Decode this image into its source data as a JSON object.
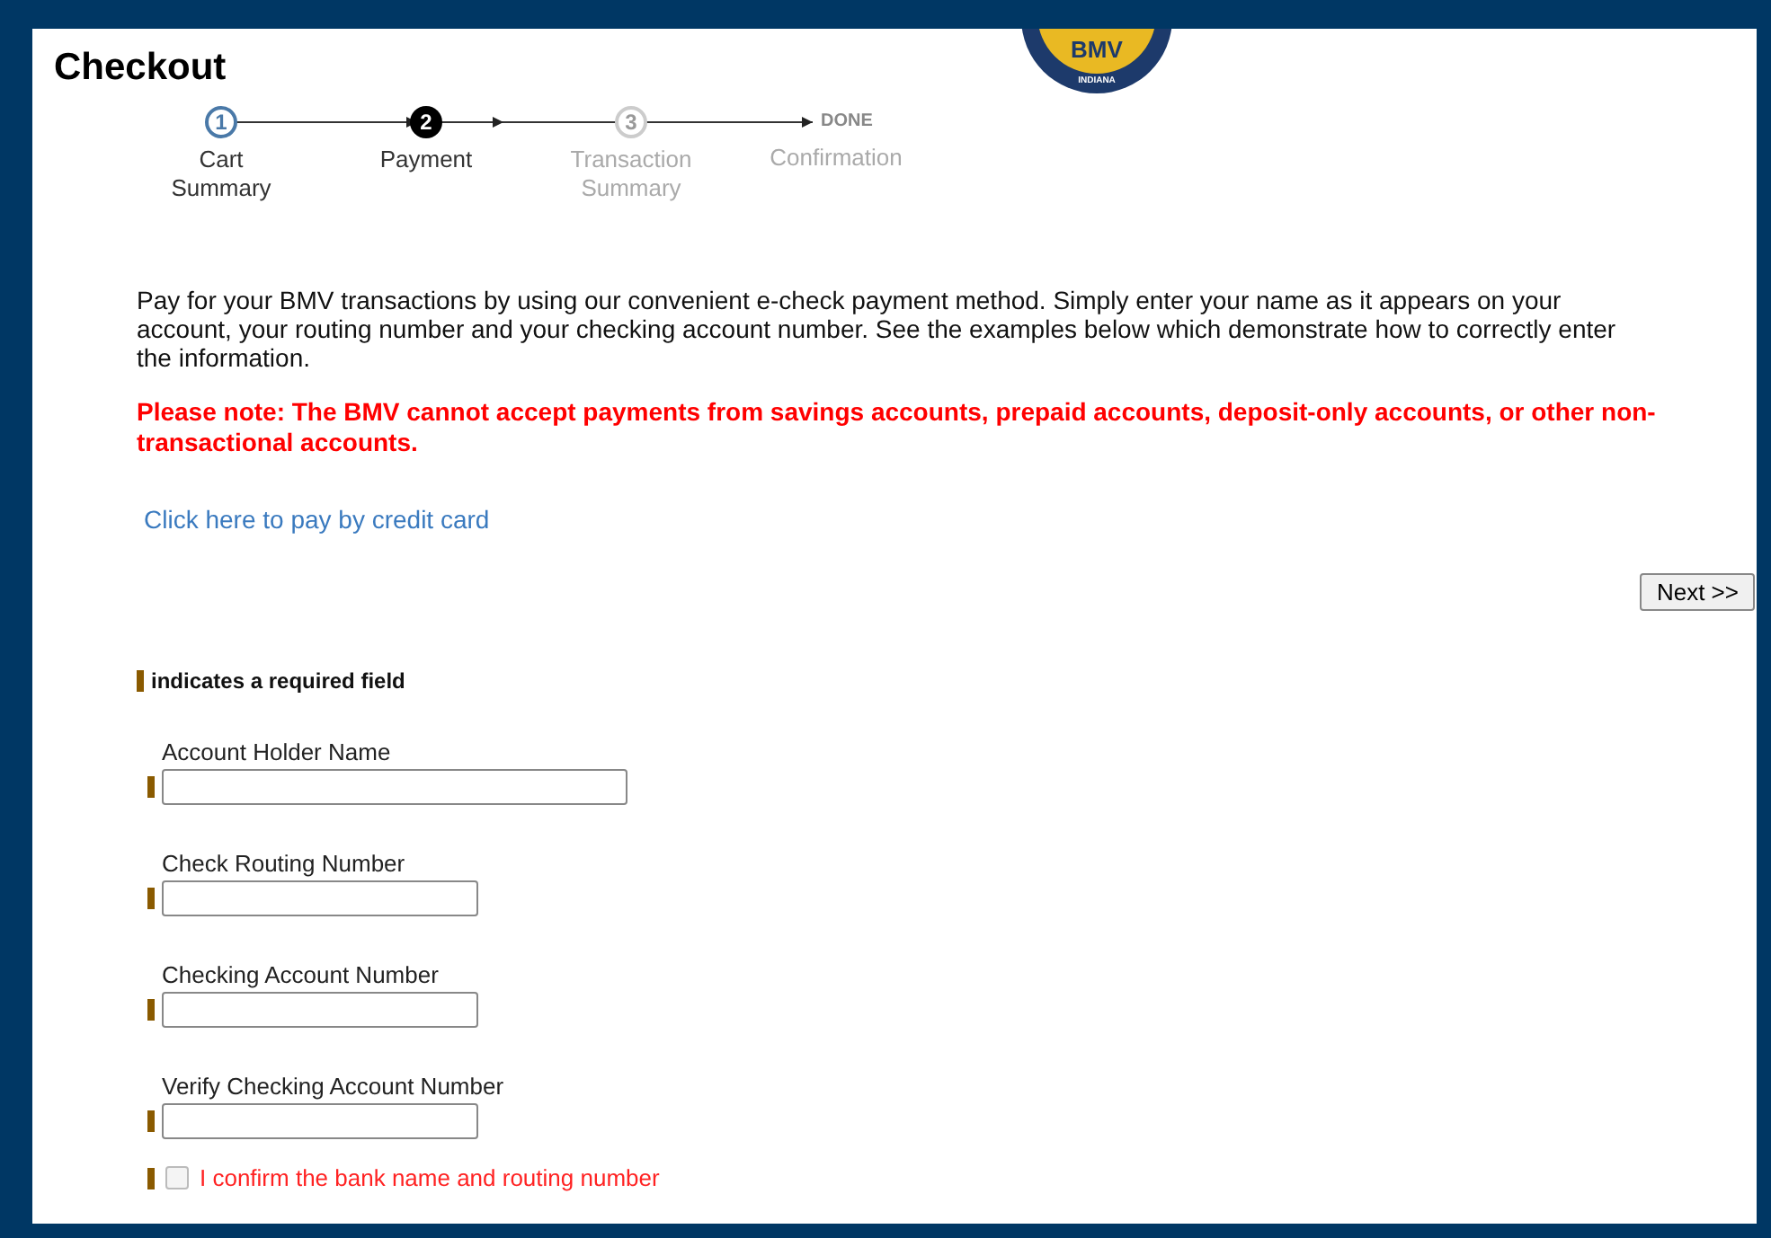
{
  "page": {
    "title": "Checkout"
  },
  "logo": {
    "text": "BMV",
    "subtext": "INDIANA"
  },
  "steps": [
    {
      "kind": "step",
      "number": "1",
      "label": "Cart Summary",
      "completed": true,
      "selected": false
    },
    {
      "kind": "step",
      "number": "2",
      "label": "Payment",
      "completed": false,
      "selected": true
    },
    {
      "kind": "step",
      "number": "3",
      "label": "Transaction Summary",
      "completed": false,
      "selected": false
    },
    {
      "kind": "end",
      "number": "DONE",
      "label": "Confirmation",
      "completed": false,
      "selected": false
    }
  ],
  "intro": "Pay for your BMV transactions by using our convenient e-check payment method.  Simply enter your name as it appears on your account, your routing number and your checking account number.  See the examples below which demonstrate how to correctly enter the information.",
  "note": "Please note: The BMV cannot accept payments from savings accounts, prepaid accounts, deposit-only accounts, or other non-transactional accounts.",
  "credit_card_link": "Click here to pay by credit card",
  "next_button": "Next >>",
  "required_legend": "indicates a required field",
  "fields": [
    {
      "label": "Account Holder Name",
      "kind": "wide"
    },
    {
      "label": "Check Routing Number",
      "kind": "short"
    },
    {
      "label": "Checking Account Number",
      "kind": "short"
    },
    {
      "label": "Verify Checking Account Number",
      "kind": "short"
    }
  ],
  "confirm": {
    "label": "I confirm the bank name and routing number",
    "checked": false
  }
}
